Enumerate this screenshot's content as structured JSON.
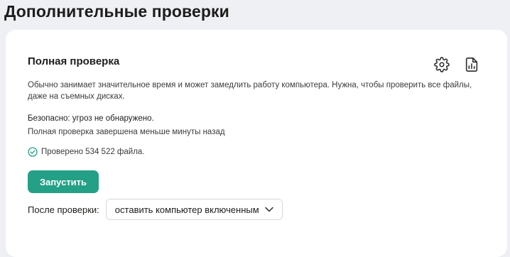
{
  "page": {
    "title": "Дополнительные проверки"
  },
  "full_scan": {
    "title": "Полная проверка",
    "description": "Обычно занимает значительное время и может замедлить работу компьютера. Нужна, чтобы проверить все файлы, даже на съемных дисках.",
    "status": "Безопасно: угроз не обнаружено.",
    "last_run": "Полная проверка завершена меньше минуты назад",
    "checked_files": "Проверено 534 522 файла.",
    "run_label": "Запустить",
    "after_label": "После проверки:",
    "after_selected": "оставить компьютер включенным",
    "icons": {
      "settings": "gear-icon",
      "report": "report-icon",
      "checked": "check-circle-icon",
      "dropdown": "chevron-down-icon"
    }
  },
  "colors": {
    "accent": "#24a086",
    "background": "#eef0f4",
    "card": "#ffffff"
  }
}
